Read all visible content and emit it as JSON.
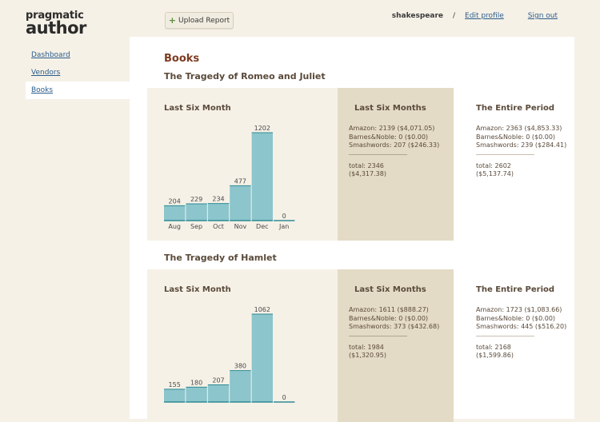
{
  "app": {
    "logo_line1": "pragmatic",
    "logo_line2": "author"
  },
  "header": {
    "upload_label": "Upload Report",
    "username": "shakespeare",
    "separator": "/",
    "edit_profile": "Edit profile",
    "sign_out": "Sign out"
  },
  "sidebar": {
    "items": [
      {
        "label": "Dashboard",
        "active": false
      },
      {
        "label": "Vendors",
        "active": false
      },
      {
        "label": "Books",
        "active": true
      }
    ]
  },
  "page": {
    "title": "Books"
  },
  "colors": {
    "bar": "#8cc5cc",
    "bar_edge": "#2f8a94",
    "six_months_bg": "#e4dbc6",
    "chart_bg": "#f6f1e7"
  },
  "books": [
    {
      "title": "The Tragedy of Romeo and Juliet",
      "chart_heading": "Last Six Month",
      "six_months": {
        "heading": "Last Six Months",
        "lines": [
          "Amazon: 2139 ($4,071.05)",
          "Barnes&Noble: 0 ($0.00)",
          "Smashwords: 207 ($246.33)"
        ],
        "total_line1": "total: 2346",
        "total_line2": "($4,317.38)"
      },
      "entire": {
        "heading": "The Entire Period",
        "lines": [
          "Amazon: 2363 ($4,853.33)",
          "Barnes&Noble: 0 ($0.00)",
          "Smashwords: 239 ($284.41)"
        ],
        "total_line1": "total: 2602",
        "total_line2": "($5,137.74)"
      }
    },
    {
      "title": "The Tragedy of Hamlet",
      "chart_heading": "Last Six Month",
      "six_months": {
        "heading": "Last Six Months",
        "lines": [
          "Amazon: 1611 ($888.27)",
          "Barnes&Noble: 0 ($0.00)",
          "Smashwords: 373 ($432.68)"
        ],
        "total_line1": "total: 1984",
        "total_line2": "($1,320.95)"
      },
      "entire": {
        "heading": "The Entire Period",
        "lines": [
          "Amazon: 1723 ($1,083.66)",
          "Barnes&Noble: 0 ($0.00)",
          "Smashwords: 445 ($516.20)"
        ],
        "total_line1": "total: 2168",
        "total_line2": "($1,599.86)"
      }
    }
  ],
  "chart_data": [
    {
      "type": "bar",
      "categories": [
        "Aug",
        "Sep",
        "Oct",
        "Nov",
        "Dec",
        "Jan"
      ],
      "values": [
        204,
        229,
        234,
        477,
        1202,
        0
      ],
      "title": "Last Six Month",
      "xlabel": "",
      "ylabel": "",
      "ylim": [
        0,
        1202
      ],
      "grid": false
    },
    {
      "type": "bar",
      "categories": [
        "Aug",
        "Sep",
        "Oct",
        "Nov",
        "Dec",
        "Jan"
      ],
      "values": [
        155,
        180,
        207,
        380,
        1062,
        0
      ],
      "title": "Last Six Month",
      "xlabel": "",
      "ylabel": "",
      "ylim": [
        0,
        1062
      ],
      "grid": false
    }
  ]
}
